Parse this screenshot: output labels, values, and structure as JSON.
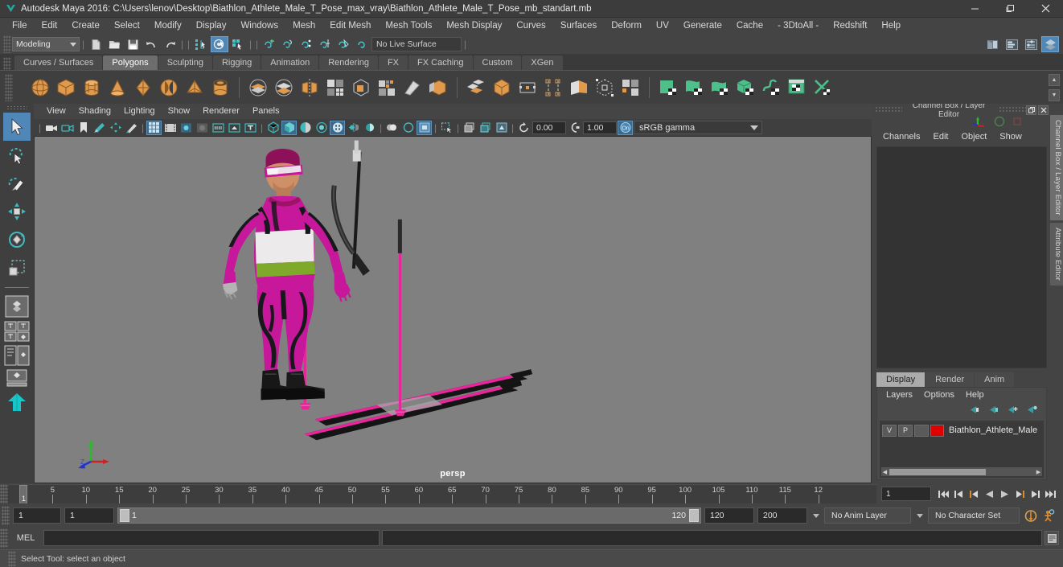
{
  "titlebar": {
    "title": "Autodesk Maya 2016: C:\\Users\\lenov\\Desktop\\Biathlon_Athlete_Male_T_Pose_max_vray\\Biathlon_Athlete_Male_T_Pose_mb_standart.mb",
    "minimize": "─",
    "maximize": "❐",
    "close": "✕"
  },
  "menubar": {
    "items": [
      "File",
      "Edit",
      "Create",
      "Select",
      "Modify",
      "Display",
      "Windows",
      "Mesh",
      "Edit Mesh",
      "Mesh Tools",
      "Mesh Display",
      "Curves",
      "Surfaces",
      "Deform",
      "UV",
      "Generate",
      "Cache",
      "- 3DtoAll -",
      "Redshift",
      "Help"
    ]
  },
  "statusline": {
    "menuset": "Modeling",
    "live_surface": "No Live Surface",
    "icons": [
      "new-scene-icon",
      "open-scene-icon",
      "save-scene-icon",
      "undo-icon",
      "redo-icon",
      "select-by-hierarchy-icon",
      "select-by-object-icon",
      "select-by-component-icon",
      "snap-to-grid-icon",
      "snap-to-curve-icon",
      "snap-to-point-icon",
      "snap-to-projected-center-icon",
      "snap-to-view-plane-icon",
      "make-live-icon"
    ],
    "right_icons": [
      "render-view-icon",
      "attribute-editor-icon",
      "tool-settings-icon",
      "channel-box-icon"
    ]
  },
  "shelf": {
    "tabs": [
      "Curves / Surfaces",
      "Polygons",
      "Sculpting",
      "Rigging",
      "Animation",
      "Rendering",
      "FX",
      "FX Caching",
      "Custom",
      "XGen"
    ],
    "active_tab": "Polygons",
    "group1": [
      "poly-sphere-icon",
      "poly-cube-icon",
      "poly-cylinder-icon",
      "poly-cone-icon",
      "poly-torus-icon",
      "poly-plane-icon",
      "poly-pyramid-icon",
      "poly-pipe-icon"
    ],
    "group2": [
      "combine-icon",
      "separate-icon",
      "mirror-geometry-icon",
      "smooth-icon",
      "boolean-icon",
      "reduce-icon",
      "sculpt-tool-icon",
      "extrude-icon",
      "bevel-icon",
      "bridge-icon",
      "append-polygon-icon",
      "multi-cut-icon",
      "target-weld-icon",
      "quad-draw-icon"
    ],
    "group3": [
      "uv-planar-icon",
      "uv-cylindrical-icon",
      "uv-spherical-icon",
      "uv-automatic-icon",
      "uv-unfold-icon",
      "uv-editor-icon",
      "uv-cut-icon"
    ]
  },
  "viewport": {
    "menus": [
      "View",
      "Shading",
      "Lighting",
      "Show",
      "Renderer",
      "Panels"
    ],
    "exposure": "0.00",
    "gamma": "1.00",
    "color_space": "sRGB gamma",
    "camera_label": "persp",
    "background": "#808080",
    "toolbar_icons": [
      "select-camera-icon",
      "lock-camera-icon",
      "bookmark-icon",
      "image-plane-icon",
      "two-d-pan-zoom-icon",
      "grease-pencil-icon",
      "grid-icon",
      "film-gate-icon",
      "resolution-gate-icon",
      "gate-mask-icon",
      "film-origin-icon",
      "exposure-icon",
      "safe-action-icon",
      "wireframe-icon",
      "smooth-shade-icon",
      "shade-wireframe-icon",
      "textured-icon",
      "use-all-lights-icon",
      "shadows-icon",
      "ambient-occlusion-icon",
      "motion-blur-icon",
      "multisample-icon",
      "isolate-select-icon",
      "xray-icon",
      "xray-joints-icon",
      "xray-active-components-icon",
      "exposure-reset-icon",
      "gamma-reset-icon",
      "color-management-icon"
    ]
  },
  "channel_box": {
    "title": "Channel Box / Layer Editor",
    "restore_glyph": "❐",
    "close_glyph": "✕",
    "menus": [
      "Channels",
      "Edit",
      "Object",
      "Show"
    ],
    "empty": ""
  },
  "layer_editor": {
    "tabs": [
      "Display",
      "Render",
      "Anim"
    ],
    "active_tab": "Display",
    "menus": [
      "Layers",
      "Options",
      "Help"
    ],
    "icons": [
      "new-layer-icon",
      "new-layer-from-selected-icon",
      "add-selected-objects-icon",
      "remove-selected-objects-icon"
    ],
    "rows": [
      {
        "visibility": "V",
        "playback": "P",
        "shading": "",
        "color": "#e00000",
        "name": "Biathlon_Athlete_Male"
      }
    ]
  },
  "side_tabs": [
    {
      "label": "Channel Box / Layer Editor",
      "selected": true
    },
    {
      "label": "Attribute Editor",
      "selected": false
    }
  ],
  "timeline": {
    "tick_labels": [
      5,
      10,
      15,
      20,
      25,
      30,
      35,
      40,
      45,
      50,
      55,
      60,
      65,
      70,
      75,
      80,
      85,
      90,
      95,
      100,
      105,
      110,
      115,
      "12"
    ],
    "current_frame": "1",
    "current_frame_field": "1",
    "playback_buttons": [
      "go-to-start-icon",
      "step-back-keyframe-icon",
      "step-back-frame-icon",
      "play-backwards-icon",
      "play-forwards-icon",
      "step-forward-frame-icon",
      "step-forward-keyframe-icon",
      "go-to-end-icon"
    ]
  },
  "range": {
    "anim_start": "1",
    "range_start": "1",
    "slider_min": "1",
    "slider_max": "120",
    "range_end": "120",
    "anim_end": "200",
    "anim_layer": "No Anim Layer",
    "character_set": "No Character Set",
    "icons": [
      "auto-keyframe-icon",
      "animation-preferences-icon"
    ]
  },
  "command_line": {
    "label": "MEL",
    "input_value": "",
    "output_value": "",
    "script-editor-icon": "script-editor-icon"
  },
  "help_line": {
    "text": "Select Tool: select an object"
  },
  "toolbox": {
    "tools": [
      "select-tool-icon",
      "lasso-select-tool-icon",
      "paint-select-tool-icon",
      "move-tool-icon",
      "rotate-tool-icon",
      "scale-tool-icon"
    ],
    "layouts": [
      "single-perspective-view-icon",
      "four-view-layout-icon",
      "persp-outliner-layout-icon",
      "persp-graph-layout-icon",
      "hypershade-layout-icon"
    ]
  }
}
